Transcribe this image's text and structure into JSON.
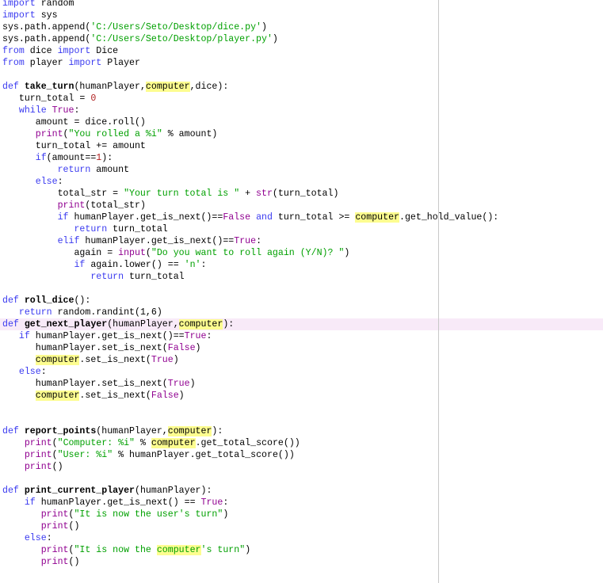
{
  "editor": {
    "current_line": 28,
    "lines": [
      [
        [
          "import",
          "k"
        ],
        [
          " random",
          ""
        ]
      ],
      [
        [
          "import",
          "k"
        ],
        [
          " sys",
          ""
        ]
      ],
      [
        [
          "sys.path.append(",
          ""
        ],
        [
          "'C:/Users/Seto/Desktop/dice.py'",
          "s"
        ],
        [
          ")",
          ""
        ]
      ],
      [
        [
          "sys.path.append(",
          ""
        ],
        [
          "'C:/Users/Seto/Desktop/player.py'",
          "s"
        ],
        [
          ")",
          ""
        ]
      ],
      [
        [
          "from",
          "k"
        ],
        [
          " dice ",
          ""
        ],
        [
          "import",
          "k"
        ],
        [
          " Dice",
          ""
        ]
      ],
      [
        [
          "from",
          "k"
        ],
        [
          " player ",
          ""
        ],
        [
          "import",
          "k"
        ],
        [
          " Player",
          ""
        ]
      ],
      [],
      [
        [
          "def",
          "k"
        ],
        [
          " ",
          ""
        ],
        [
          "take_turn",
          "f"
        ],
        [
          "(humanPlayer,",
          ""
        ],
        [
          "computer",
          "h"
        ],
        [
          ",dice):",
          ""
        ]
      ],
      [
        [
          "   turn_total = ",
          ""
        ],
        [
          "0",
          "n"
        ]
      ],
      [
        [
          "   ",
          ""
        ],
        [
          "while",
          "k"
        ],
        [
          " ",
          ""
        ],
        [
          "True",
          "b"
        ],
        [
          ":",
          ""
        ]
      ],
      [
        [
          "      amount = dice.roll()",
          ""
        ]
      ],
      [
        [
          "      ",
          ""
        ],
        [
          "print",
          "b"
        ],
        [
          "(",
          ""
        ],
        [
          "\"You rolled a %i\"",
          "s"
        ],
        [
          " % amount)",
          ""
        ]
      ],
      [
        [
          "      turn_total += amount",
          ""
        ]
      ],
      [
        [
          "      ",
          ""
        ],
        [
          "if",
          "k"
        ],
        [
          "(amount==",
          ""
        ],
        [
          "1",
          "n"
        ],
        [
          "):",
          ""
        ]
      ],
      [
        [
          "          ",
          ""
        ],
        [
          "return",
          "k"
        ],
        [
          " amount",
          ""
        ]
      ],
      [
        [
          "      ",
          ""
        ],
        [
          "else",
          "k"
        ],
        [
          ":",
          ""
        ]
      ],
      [
        [
          "          total_str = ",
          ""
        ],
        [
          "\"Your turn total is \"",
          "s"
        ],
        [
          " + ",
          ""
        ],
        [
          "str",
          "b"
        ],
        [
          "(turn_total)",
          ""
        ]
      ],
      [
        [
          "          ",
          ""
        ],
        [
          "print",
          "b"
        ],
        [
          "(total_str)",
          ""
        ]
      ],
      [
        [
          "          ",
          ""
        ],
        [
          "if",
          "k"
        ],
        [
          " humanPlayer.get_is_next()==",
          ""
        ],
        [
          "False",
          "b"
        ],
        [
          " ",
          ""
        ],
        [
          "and",
          "k"
        ],
        [
          " turn_total >= ",
          ""
        ],
        [
          "computer",
          "h"
        ],
        [
          ".get_hold_value():",
          ""
        ]
      ],
      [
        [
          "             ",
          ""
        ],
        [
          "return",
          "k"
        ],
        [
          " turn_total",
          ""
        ]
      ],
      [
        [
          "          ",
          ""
        ],
        [
          "elif",
          "k"
        ],
        [
          " humanPlayer.get_is_next()==",
          ""
        ],
        [
          "True",
          "b"
        ],
        [
          ":",
          ""
        ]
      ],
      [
        [
          "             again = ",
          ""
        ],
        [
          "input",
          "b"
        ],
        [
          "(",
          ""
        ],
        [
          "\"Do you want to roll again (Y/N)? \"",
          "s"
        ],
        [
          ")",
          ""
        ]
      ],
      [
        [
          "             ",
          ""
        ],
        [
          "if",
          "k"
        ],
        [
          " again.lower() == ",
          ""
        ],
        [
          "'n'",
          "s"
        ],
        [
          ":",
          ""
        ]
      ],
      [
        [
          "                ",
          ""
        ],
        [
          "return",
          "k"
        ],
        [
          " turn_total",
          ""
        ]
      ],
      [],
      [
        [
          "def",
          "k"
        ],
        [
          " ",
          ""
        ],
        [
          "roll_dice",
          "f"
        ],
        [
          "():",
          ""
        ]
      ],
      [
        [
          "   ",
          ""
        ],
        [
          "return",
          "k"
        ],
        [
          " random.randint(1,6)",
          ""
        ]
      ],
      [
        [
          "def",
          "k"
        ],
        [
          " ",
          ""
        ],
        [
          "get_next_player",
          "f"
        ],
        [
          "(humanPlayer,",
          ""
        ],
        [
          "computer",
          "h"
        ],
        [
          "):",
          ""
        ]
      ],
      [
        [
          "   ",
          ""
        ],
        [
          "if",
          "k"
        ],
        [
          " humanPlayer.get_is_next()==",
          ""
        ],
        [
          "True",
          "b"
        ],
        [
          ":",
          ""
        ]
      ],
      [
        [
          "      humanPlayer.set_is_next(",
          ""
        ],
        [
          "False",
          "b"
        ],
        [
          ")",
          ""
        ]
      ],
      [
        [
          "      ",
          ""
        ],
        [
          "computer",
          "h"
        ],
        [
          ".set_is_next(",
          ""
        ],
        [
          "True",
          "b"
        ],
        [
          ")",
          ""
        ]
      ],
      [
        [
          "   ",
          ""
        ],
        [
          "else",
          "k"
        ],
        [
          ":",
          ""
        ]
      ],
      [
        [
          "      humanPlayer.set_is_next(",
          ""
        ],
        [
          "True",
          "b"
        ],
        [
          ")",
          ""
        ]
      ],
      [
        [
          "      ",
          ""
        ],
        [
          "computer",
          "h"
        ],
        [
          ".set_is_next(",
          ""
        ],
        [
          "False",
          "b"
        ],
        [
          ")",
          ""
        ]
      ],
      [],
      [],
      [
        [
          "def",
          "k"
        ],
        [
          " ",
          ""
        ],
        [
          "report_points",
          "f"
        ],
        [
          "(humanPlayer,",
          ""
        ],
        [
          "computer",
          "h"
        ],
        [
          "):",
          ""
        ]
      ],
      [
        [
          "    ",
          ""
        ],
        [
          "print",
          "b"
        ],
        [
          "(",
          ""
        ],
        [
          "\"Computer: %i\"",
          "s"
        ],
        [
          " % ",
          ""
        ],
        [
          "computer",
          "h"
        ],
        [
          ".get_total_score())",
          ""
        ]
      ],
      [
        [
          "    ",
          ""
        ],
        [
          "print",
          "b"
        ],
        [
          "(",
          ""
        ],
        [
          "\"User: %i\"",
          "s"
        ],
        [
          " % humanPlayer.get_total_score())",
          ""
        ]
      ],
      [
        [
          "    ",
          ""
        ],
        [
          "print",
          "b"
        ],
        [
          "()",
          ""
        ]
      ],
      [],
      [
        [
          "def",
          "k"
        ],
        [
          " ",
          ""
        ],
        [
          "print_current_player",
          "f"
        ],
        [
          "(humanPlayer):",
          ""
        ]
      ],
      [
        [
          "    ",
          ""
        ],
        [
          "if",
          "k"
        ],
        [
          " humanPlayer.get_is_next() == ",
          ""
        ],
        [
          "True",
          "b"
        ],
        [
          ":",
          ""
        ]
      ],
      [
        [
          "       ",
          ""
        ],
        [
          "print",
          "b"
        ],
        [
          "(",
          ""
        ],
        [
          "\"It is now the user's turn\"",
          "s"
        ],
        [
          ")",
          ""
        ]
      ],
      [
        [
          "       ",
          ""
        ],
        [
          "print",
          "b"
        ],
        [
          "()",
          ""
        ]
      ],
      [
        [
          "    ",
          ""
        ],
        [
          "else",
          "k"
        ],
        [
          ":",
          ""
        ]
      ],
      [
        [
          "       ",
          ""
        ],
        [
          "print",
          "b"
        ],
        [
          "(",
          ""
        ],
        [
          "\"It is now the ",
          "s"
        ],
        [
          "computer",
          "h s"
        ],
        [
          "'s turn\"",
          "s"
        ],
        [
          ")",
          ""
        ]
      ],
      [
        [
          "       ",
          ""
        ],
        [
          "print",
          "b"
        ],
        [
          "()",
          ""
        ]
      ]
    ]
  }
}
